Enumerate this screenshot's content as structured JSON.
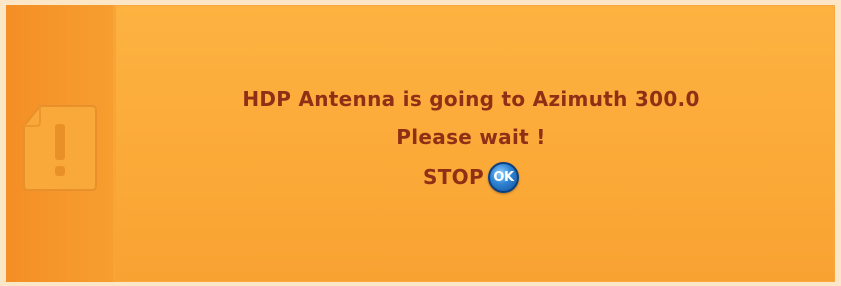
{
  "dialog": {
    "message_line1": "HDP Antenna is going to Azimuth 300.0",
    "message_line2": "Please wait !",
    "stop_label": "STOP",
    "ok_button_label": "OK"
  },
  "icons": {
    "warning": "warning-icon"
  },
  "colors": {
    "dialog_background": "#fbaa38",
    "side_strip": "#f48e25",
    "text": "#8f2f16",
    "ok_button": "#2e82d3"
  }
}
